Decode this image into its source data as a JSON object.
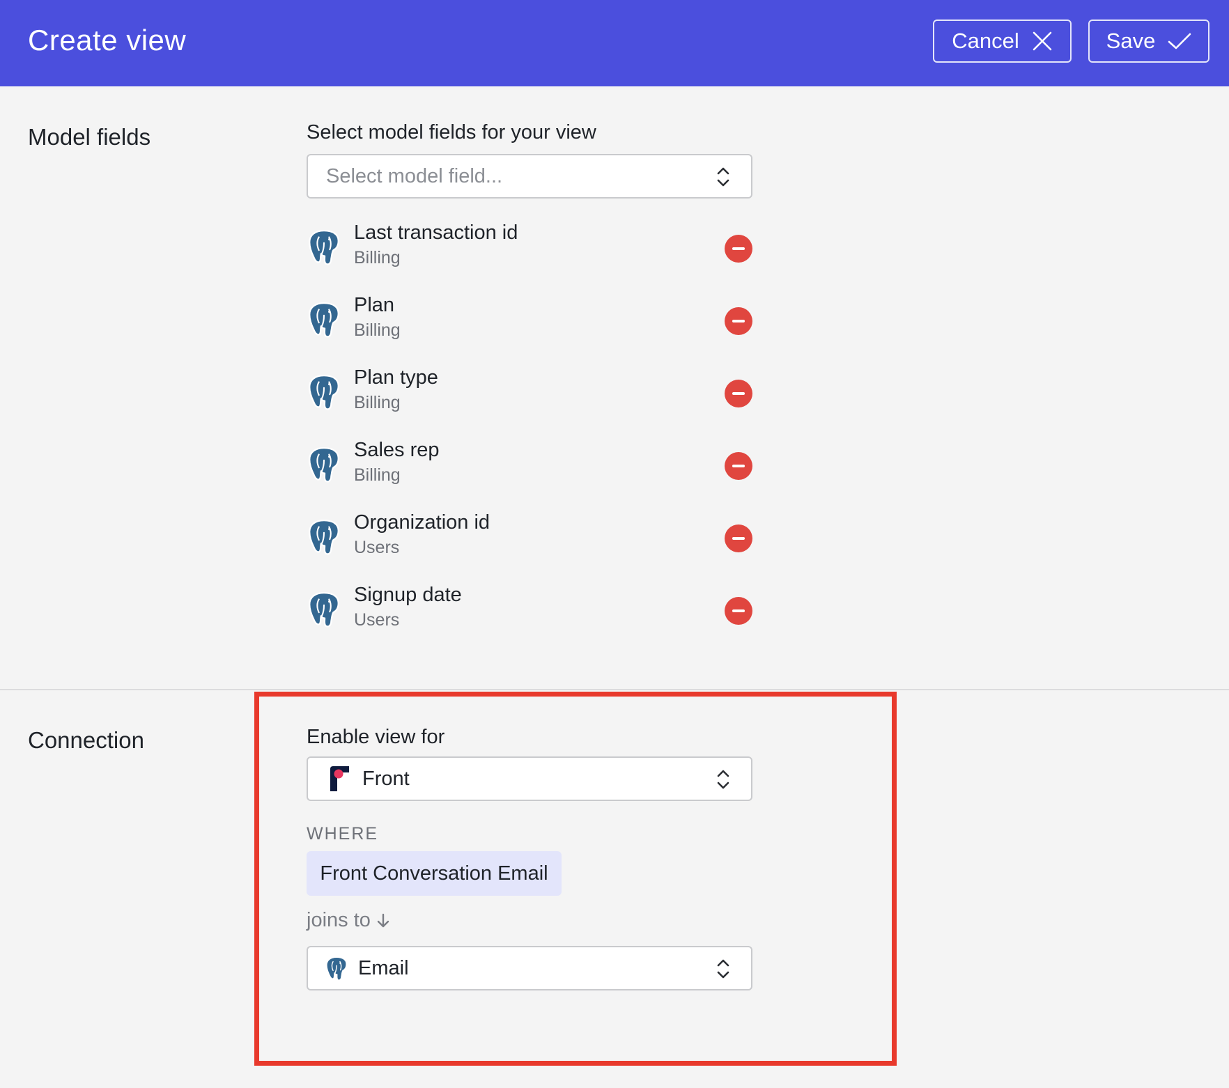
{
  "header": {
    "title": "Create view",
    "cancel_label": "Cancel",
    "save_label": "Save"
  },
  "model_fields": {
    "section_title": "Model fields",
    "select_label": "Select model fields for your view",
    "select_placeholder": "Select model field...",
    "fields": [
      {
        "name": "Last transaction id",
        "source": "Billing",
        "icon": "postgres-icon"
      },
      {
        "name": "Plan",
        "source": "Billing",
        "icon": "postgres-icon"
      },
      {
        "name": "Plan type",
        "source": "Billing",
        "icon": "postgres-icon"
      },
      {
        "name": "Sales rep",
        "source": "Billing",
        "icon": "postgres-icon"
      },
      {
        "name": "Organization id",
        "source": "Users",
        "icon": "postgres-icon"
      },
      {
        "name": "Signup date",
        "source": "Users",
        "icon": "postgres-icon"
      }
    ]
  },
  "connection": {
    "section_title": "Connection",
    "enable_label": "Enable view for",
    "enable_value": "Front",
    "where_label": "WHERE",
    "where_chip": "Front Conversation Email",
    "joins_label": "joins to",
    "join_value": "Email"
  },
  "colors": {
    "header_bg": "#4b4fdd",
    "remove": "#e0463f",
    "highlight_border": "#e8392c",
    "chip_bg": "#e3e5fb"
  }
}
